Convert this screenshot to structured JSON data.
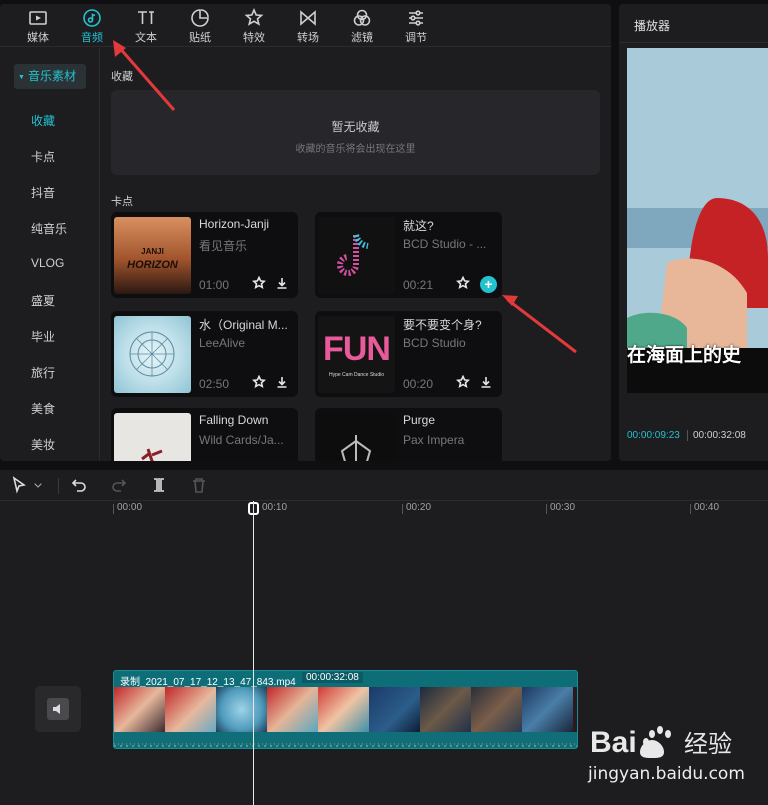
{
  "toolbar": {
    "tabs": [
      {
        "label": "媒体",
        "icon": "media-icon"
      },
      {
        "label": "音频",
        "icon": "audio-icon"
      },
      {
        "label": "文本",
        "icon": "text-icon"
      },
      {
        "label": "贴纸",
        "icon": "sticker-icon"
      },
      {
        "label": "特效",
        "icon": "effects-icon"
      },
      {
        "label": "转场",
        "icon": "transition-icon"
      },
      {
        "label": "滤镜",
        "icon": "filter-icon"
      },
      {
        "label": "调节",
        "icon": "adjust-icon"
      }
    ],
    "active_tab": "音频",
    "accent_color": "#22c2cf"
  },
  "sidebar": {
    "header": "音乐素材",
    "items": [
      "收藏",
      "卡点",
      "抖音",
      "纯音乐",
      "VLOG",
      "盛夏",
      "毕业",
      "旅行",
      "美食",
      "美妆"
    ],
    "active_item": "收藏"
  },
  "favorites": {
    "title": "收藏",
    "empty_title": "暂无收藏",
    "empty_hint": "收藏的音乐将会出现在这里"
  },
  "kadian": {
    "title": "卡点",
    "tracks": [
      {
        "name": "Horizon-Janji",
        "artist": "看见音乐",
        "duration": "01:00",
        "cover_text_1": "JANJI",
        "cover_text_2": "HORIZON"
      },
      {
        "name": "就这?",
        "artist": "BCD Studio - ...",
        "duration": "00:21",
        "cover_text_1": "",
        "cover_text_2": ""
      },
      {
        "name": "水（Original M...",
        "artist": "LeeAlive",
        "duration": "02:50",
        "cover_text_1": "",
        "cover_text_2": ""
      },
      {
        "name": "要不要变个身?",
        "artist": "BCD Studio",
        "duration": "00:20",
        "cover_text_1": "FUN",
        "cover_text_2": "Hype Cam Dance Studio"
      },
      {
        "name": "Falling Down",
        "artist": "Wild Cards/Ja...",
        "duration": "",
        "cover_text_1": "",
        "cover_text_2": ""
      },
      {
        "name": "Purge",
        "artist": "Pax Impera",
        "duration": "",
        "cover_text_1": "",
        "cover_text_2": ""
      }
    ]
  },
  "player": {
    "title": "播放器",
    "subtitle_text": "在海面上的史",
    "current_time": "00:00:09:23",
    "total_time": "00:00:32:08"
  },
  "timeline": {
    "ticks": [
      "00:00",
      "00:10",
      "00:20",
      "00:30",
      "00:40"
    ],
    "clip": {
      "name": "录制_2021_07_17_12_13_47_843.mp4",
      "duration": "00:00:32:08"
    }
  },
  "watermark": {
    "text": "jingyan.baidu.com",
    "logo_text": "Bai 经验"
  }
}
